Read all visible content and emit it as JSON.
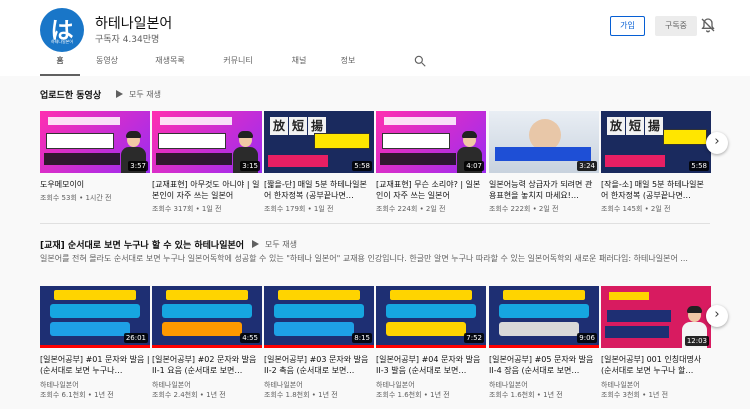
{
  "channel": {
    "name": "하테나일본어",
    "subscribers": "구독자 4.34만명",
    "avatar_text": "は",
    "avatar_subtext": "하테나일본어",
    "join_label": "가입",
    "subscribe_label": "구독중"
  },
  "tabs": [
    "홈",
    "동영상",
    "재생목록",
    "커뮤니티",
    "채널",
    "정보"
  ],
  "uploads": {
    "title": "업로드한 동영상",
    "play_all": "모두 재생",
    "videos": [
      {
        "title": "도우메모이이",
        "channel": "",
        "meta": "조회수 53회 • 1시간 전",
        "duration": "3:57"
      },
      {
        "title": "[교재표현] 아무것도 아니야 | 일본인이 자주 쓰는 일본어",
        "channel": "",
        "meta": "조회수 317회 • 1일 전",
        "duration": "3:15"
      },
      {
        "title": "[짧을-단] 매일 5분 하테나일본어 한자정복 (공부끝나면…",
        "channel": "",
        "meta": "조회수 179회 • 1일 전",
        "duration": "5:58"
      },
      {
        "title": "[교재표현] 무슨 소리야? | 일본인이 자주 쓰는 일본어",
        "channel": "",
        "meta": "조회수 224회 • 2일 전",
        "duration": "4:07"
      },
      {
        "title": "일본어능력 상급자가 되려면 관용표현을 놓치지 마세요!…",
        "channel": "",
        "meta": "조회수 222회 • 2일 전",
        "duration": "3:24"
      },
      {
        "title": "[작을-소] 매일 5분 하테나일본어 한자정복 (공부끝나면…",
        "channel": "",
        "meta": "조회수 145회 • 2일 전",
        "duration": "5:58"
      }
    ]
  },
  "playlist": {
    "title": "[교재] 순서대로 보면 누구나 할 수 있는 하테나일본어",
    "play_all": "모두 재생",
    "description": "일본어를 전혀 몰라도 순서대로 보면 누구나 일본어독학에 성공할 수 있는 \"하테나 일본어\" 교재용 인강입니다. 한글만 알면 누구나 따라할 수 있는 일본어독학의 새로운 패러다임: 하테나일본어 ...",
    "videos": [
      {
        "title": "[일본어공부] #01 문자와 발음 | (순서대로 보면 누구나…",
        "channel": "하테나일본어",
        "meta": "조회수 6.1천회 • 1년 전",
        "duration": "26:01",
        "line1": "일본어독학 : 순서대로 보면 끝!",
        "line2": "#00-1 문자와 발음(청음)",
        "line3": "일본어공부 시작!"
      },
      {
        "title": "[일본어공부] #02 문자와 발음 II-1 요음 (순서대로 보면…",
        "channel": "하테나일본어",
        "meta": "조회수 2.4천회 • 1년 전",
        "duration": "4:55",
        "line1": "일본어독학 : 순서대로 보면 끝!",
        "line2": "#00-2 문자와 발음(요음)",
        "line3": "두글자를, 한번만 발음해요?!"
      },
      {
        "title": "[일본어공부] #03 문자와 발음 II-2 촉음 (순서대로 보면…",
        "channel": "하테나일본어",
        "meta": "조회수 1.8천회 • 1년 전",
        "duration": "8:15",
        "line1": "일본어독학 : 순서대로 보면 끝!",
        "line2": "#00-3 문자와 발음(촉음)",
        "line3": "받침 발음 이렇게 하면 쉬워요"
      },
      {
        "title": "[일본어공부] #04 문자와 발음 II-3 발음 (순서대로 보면…",
        "channel": "하테나일본어",
        "meta": "조회수 1.6천회 • 1년 전",
        "duration": "7:52",
        "line1": "일본어독학 : 순서대로 보면 끝!",
        "line2": "#00-4 문자와 발음(발음)",
        "line3": "핵심은 입술에 있습니다!"
      },
      {
        "title": "[일본어공부] #05 문자와 발음 II-4 장음 (순서대로 보면…",
        "channel": "하테나일본어",
        "meta": "조회수 1.6천회 • 1년 전",
        "duration": "9:06",
        "line1": "일본어독학 : 순서대로 보면 끝!",
        "line2": "#00-5 문자와 발음(장음)",
        "line3": "우습게 봤다간 큰 코 다쳐요!"
      },
      {
        "title": "[일본어공부] 001 인칭대명사 (순서대로 보면 누구나 할…",
        "channel": "하테나일본어",
        "meta": "조회수 3천회 • 1년 전",
        "duration": "12:03",
        "line1": "일본어독학",
        "line2": "#01 인칭대명사",
        "line3": "나... 그리고 그녀"
      }
    ]
  },
  "colors": {
    "brand_blue": "#1976c8",
    "accent_red": "#ff0000",
    "link_blue": "#065fd4"
  }
}
